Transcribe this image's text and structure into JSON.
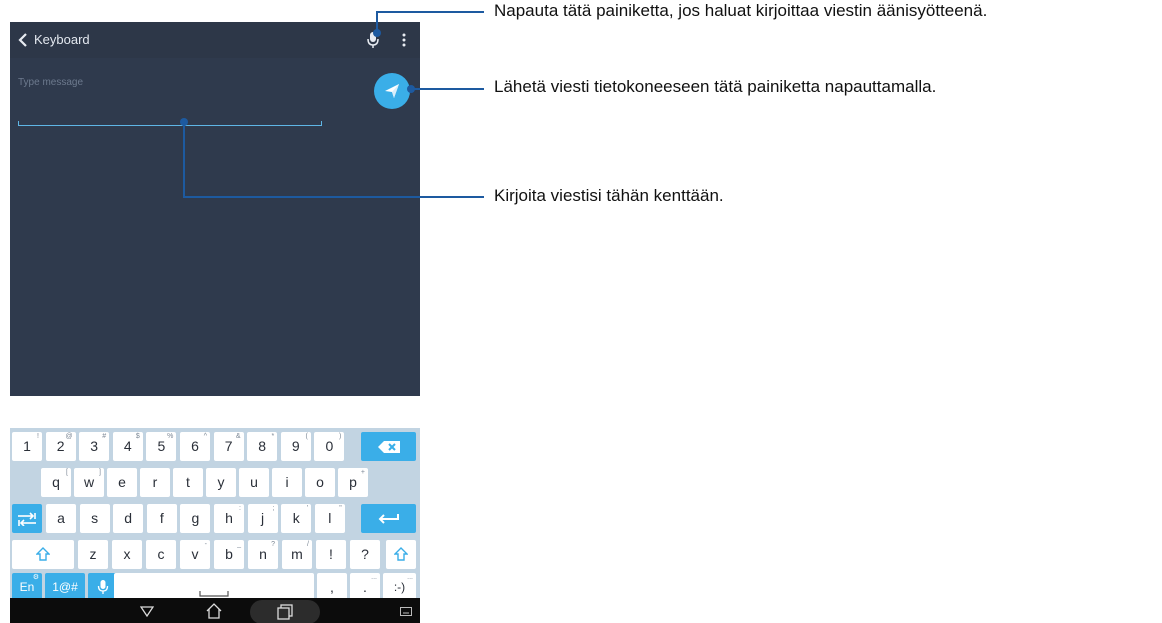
{
  "appbar": {
    "title": "Keyboard",
    "icons": [
      "back-chevron-icon",
      "microphone-icon",
      "more-vert-icon"
    ]
  },
  "compose": {
    "placeholder": "Type message",
    "send_icon": "send-paper-plane-icon"
  },
  "keyboard": {
    "row1": [
      {
        "k": "1",
        "s": "!"
      },
      {
        "k": "2",
        "s": "@"
      },
      {
        "k": "3",
        "s": "#"
      },
      {
        "k": "4",
        "s": "$"
      },
      {
        "k": "5",
        "s": "%"
      },
      {
        "k": "6",
        "s": "^"
      },
      {
        "k": "7",
        "s": "&"
      },
      {
        "k": "8",
        "s": "*"
      },
      {
        "k": "9",
        "s": "("
      },
      {
        "k": "0",
        "s": ")"
      }
    ],
    "row2": [
      {
        "k": "q",
        "s": "["
      },
      {
        "k": "w",
        "s": "]"
      },
      {
        "k": "e",
        "s": ""
      },
      {
        "k": "r",
        "s": ""
      },
      {
        "k": "t",
        "s": ""
      },
      {
        "k": "y",
        "s": ""
      },
      {
        "k": "u",
        "s": ""
      },
      {
        "k": "i",
        "s": ""
      },
      {
        "k": "o",
        "s": ""
      },
      {
        "k": "p",
        "s": "+"
      }
    ],
    "row3": [
      {
        "k": "a",
        "s": ""
      },
      {
        "k": "s",
        "s": ""
      },
      {
        "k": "d",
        "s": ""
      },
      {
        "k": "f",
        "s": ""
      },
      {
        "k": "g",
        "s": ""
      },
      {
        "k": "h",
        "s": ":"
      },
      {
        "k": "j",
        "s": ";"
      },
      {
        "k": "k",
        "s": "'"
      },
      {
        "k": "l",
        "s": "\""
      }
    ],
    "row4": [
      {
        "k": "z",
        "s": ""
      },
      {
        "k": "x",
        "s": ""
      },
      {
        "k": "c",
        "s": ""
      },
      {
        "k": "v",
        "s": "-"
      },
      {
        "k": "b",
        "s": "_"
      },
      {
        "k": "n",
        "s": "?"
      },
      {
        "k": "m",
        "s": "/"
      },
      {
        "k": "!",
        "s": ""
      },
      {
        "k": "?",
        "s": ""
      }
    ],
    "lang_key": "En",
    "lang_sup": "⚙",
    "symbols_key": "1@#",
    "comma_key": ",",
    "period_key": ".",
    "period_sup": "...",
    "smiley_key": ":-)",
    "smiley_sup": "..."
  },
  "callouts": {
    "mic": "Napauta tätä painiketta, jos haluat kirjoittaa viestin äänisyötteenä.",
    "send": "Lähetä viesti tietokoneeseen tätä painiketta napauttamalla.",
    "field": "Kirjoita viestisi tähän kenttään."
  },
  "colors": {
    "screen_bg": "#2f3a4d",
    "accent": "#3aaee8",
    "keyboard_bg": "#c2d4e2",
    "callout_line": "#1d5aa0"
  }
}
